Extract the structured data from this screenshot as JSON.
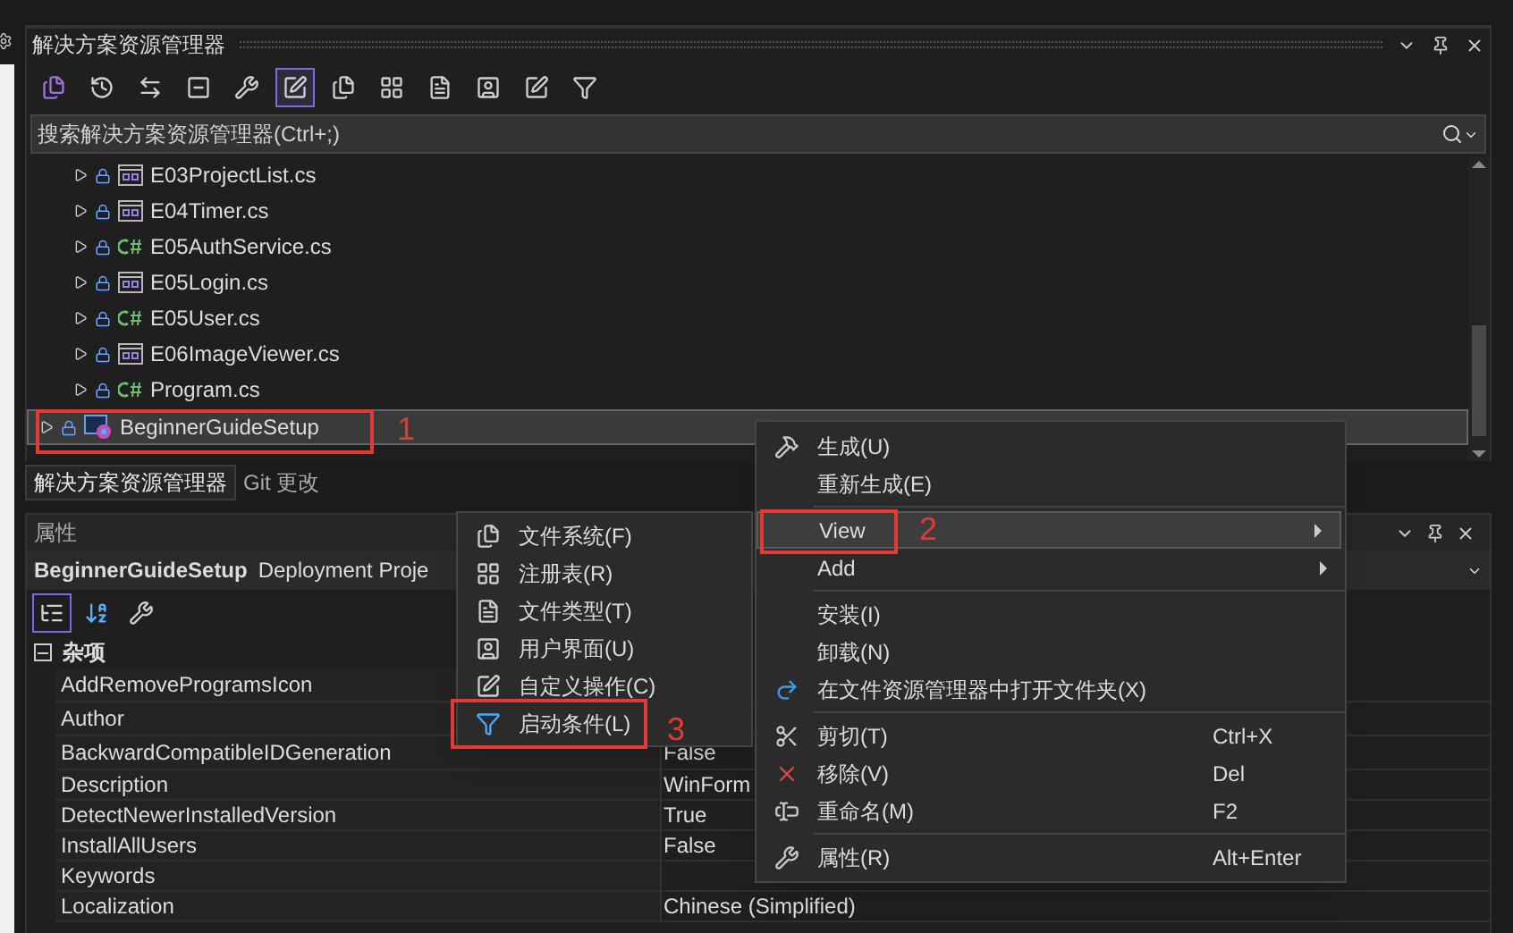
{
  "solution_explorer": {
    "title": "解决方案资源管理器",
    "toolbar": [
      {
        "kind": "solution",
        "selected": false
      },
      {
        "kind": "history",
        "selected": false
      },
      {
        "kind": "sync",
        "selected": false
      },
      {
        "kind": "collapse",
        "selected": false
      },
      {
        "kind": "properties",
        "selected": false
      },
      {
        "kind": "preview",
        "selected": true
      },
      {
        "kind": "file-system",
        "selected": false
      },
      {
        "kind": "registry",
        "selected": false
      },
      {
        "kind": "file-types",
        "selected": false
      },
      {
        "kind": "user-interface",
        "selected": false
      },
      {
        "kind": "custom-actions",
        "selected": false
      },
      {
        "kind": "launch-conditions",
        "selected": false
      }
    ],
    "search": {
      "placeholder": "搜索解决方案资源管理器(Ctrl+;)"
    },
    "tree": [
      {
        "name": "E03ProjectList.cs",
        "kind": "form",
        "selected": false
      },
      {
        "name": "E04Timer.cs",
        "kind": "form",
        "selected": false
      },
      {
        "name": "E05AuthService.cs",
        "kind": "csharp",
        "selected": false
      },
      {
        "name": "E05Login.cs",
        "kind": "form",
        "selected": false
      },
      {
        "name": "E05User.cs",
        "kind": "csharp",
        "selected": false
      },
      {
        "name": "E06ImageViewer.cs",
        "kind": "form",
        "selected": false
      },
      {
        "name": "Program.cs",
        "kind": "csharp",
        "selected": false
      },
      {
        "name": "BeginnerGuideSetup",
        "kind": "setup",
        "selected": true
      }
    ]
  },
  "tabs": [
    {
      "label": "解决方案资源管理器",
      "selected": true
    },
    {
      "label": "Git 更改",
      "selected": false
    }
  ],
  "properties": {
    "title": "属性",
    "object_name": "BeginnerGuideSetup",
    "object_type": "Deployment Proje",
    "toolbar": [
      {
        "kind": "categorized",
        "selected": true
      },
      {
        "kind": "alphabetical",
        "selected": false
      },
      {
        "kind": "property-pages",
        "selected": false
      }
    ],
    "category": {
      "label": "杂项",
      "expanded": true
    },
    "rows": [
      {
        "name": "AddRemoveProgramsIcon"
      },
      {
        "name": "Author"
      },
      {
        "name": "BackwardCompatibleIDGeneration",
        "value": "False"
      },
      {
        "name": "Description",
        "value": "WinForm"
      },
      {
        "name": "DetectNewerInstalledVersion",
        "value": "True"
      },
      {
        "name": "InstallAllUsers",
        "value": "False"
      },
      {
        "name": "Keywords"
      },
      {
        "name": "Localization",
        "value": "Chinese (Simplified)"
      }
    ]
  },
  "context_menu": {
    "groups": [
      [
        {
          "label": "生成(U)",
          "kind": "build",
          "submenu": false,
          "selected": false
        },
        {
          "label": "重新生成(E)",
          "kind": "plain",
          "submenu": false,
          "selected": false
        }
      ],
      [
        {
          "label": "View",
          "kind": "plain",
          "submenu": true,
          "selected": true
        },
        {
          "label": "Add",
          "kind": "plain",
          "submenu": true,
          "selected": false
        }
      ],
      [
        {
          "label": "安装(I)",
          "kind": "plain",
          "submenu": false,
          "selected": false
        },
        {
          "label": "卸载(N)",
          "kind": "plain",
          "submenu": false,
          "selected": false
        },
        {
          "label": "在文件资源管理器中打开文件夹(X)",
          "kind": "open-folder",
          "submenu": false,
          "selected": false
        }
      ],
      [
        {
          "label": "剪切(T)",
          "kind": "cut",
          "shortcut": "Ctrl+X",
          "submenu": false,
          "selected": false
        },
        {
          "label": "移除(V)",
          "kind": "remove",
          "shortcut": "Del",
          "submenu": false,
          "selected": false
        },
        {
          "label": "重命名(M)",
          "kind": "rename",
          "shortcut": "F2",
          "submenu": false,
          "selected": false
        }
      ],
      [
        {
          "label": "属性(R)",
          "kind": "properties",
          "shortcut": "Alt+Enter",
          "submenu": false,
          "selected": false
        }
      ]
    ]
  },
  "submenu": [
    {
      "label": "文件系统(F)",
      "kind": "file-system"
    },
    {
      "label": "注册表(R)",
      "kind": "registry"
    },
    {
      "label": "文件类型(T)",
      "kind": "file-types"
    },
    {
      "label": "用户界面(U)",
      "kind": "user-interface"
    },
    {
      "label": "自定义操作(C)",
      "kind": "custom-actions"
    },
    {
      "label": "启动条件(L)",
      "kind": "launch-conditions"
    }
  ],
  "annotations": [
    {
      "label": "1"
    },
    {
      "label": "2"
    },
    {
      "label": "3"
    }
  ]
}
